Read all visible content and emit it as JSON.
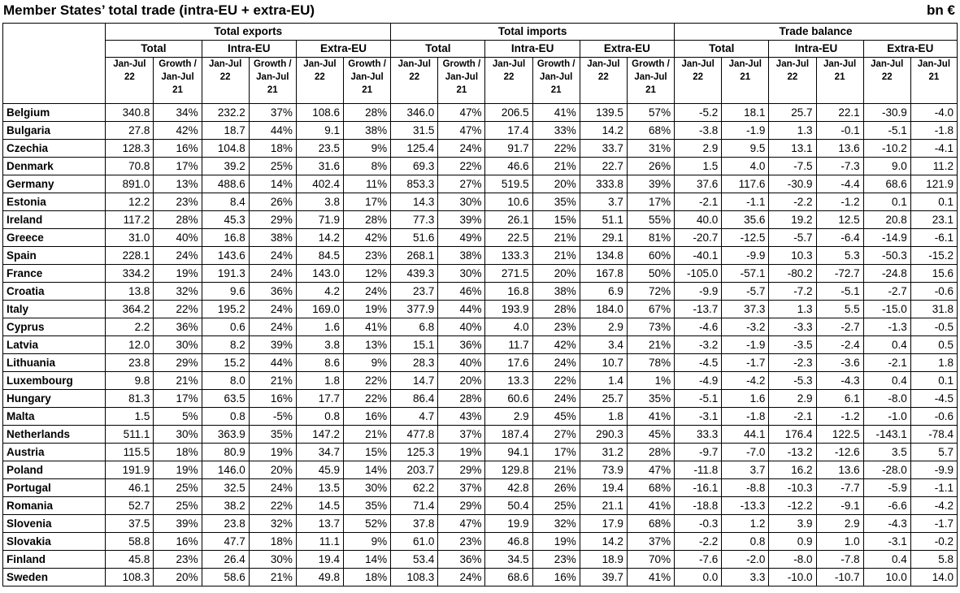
{
  "title": "Member States’ total trade (intra-EU + extra-EU)",
  "unit": "bn €",
  "groups": [
    "Total exports",
    "Total imports",
    "Trade balance"
  ],
  "subgroups": [
    "Total",
    "Intra-EU",
    "Extra-EU",
    "Total",
    "Intra-EU",
    "Extra-EU",
    "Total",
    "Intra-EU",
    "Extra-EU"
  ],
  "cols": [
    "Jan-Jul 22",
    "Growth / Jan-Jul 21",
    "Jan-Jul 22",
    "Growth / Jan-Jul 21",
    "Jan-Jul 22",
    "Growth / Jan-Jul 21",
    "Jan-Jul 22",
    "Growth / Jan-Jul 21",
    "Jan-Jul 22",
    "Growth / Jan-Jul 21",
    "Jan-Jul 22",
    "Growth / Jan-Jul 21",
    "Jan-Jul 22",
    "Jan-Jul 21",
    "Jan-Jul 22",
    "Jan-Jul 21",
    "Jan-Jul 22",
    "Jan-Jul 21"
  ],
  "rows": [
    [
      "Belgium",
      "340.8",
      "34%",
      "232.2",
      "37%",
      "108.6",
      "28%",
      "346.0",
      "47%",
      "206.5",
      "41%",
      "139.5",
      "57%",
      "-5.2",
      "18.1",
      "25.7",
      "22.1",
      "-30.9",
      "-4.0"
    ],
    [
      "Bulgaria",
      "27.8",
      "42%",
      "18.7",
      "44%",
      "9.1",
      "38%",
      "31.5",
      "47%",
      "17.4",
      "33%",
      "14.2",
      "68%",
      "-3.8",
      "-1.9",
      "1.3",
      "-0.1",
      "-5.1",
      "-1.8"
    ],
    [
      "Czechia",
      "128.3",
      "16%",
      "104.8",
      "18%",
      "23.5",
      "9%",
      "125.4",
      "24%",
      "91.7",
      "22%",
      "33.7",
      "31%",
      "2.9",
      "9.5",
      "13.1",
      "13.6",
      "-10.2",
      "-4.1"
    ],
    [
      "Denmark",
      "70.8",
      "17%",
      "39.2",
      "25%",
      "31.6",
      "8%",
      "69.3",
      "22%",
      "46.6",
      "21%",
      "22.7",
      "26%",
      "1.5",
      "4.0",
      "-7.5",
      "-7.3",
      "9.0",
      "11.2"
    ],
    [
      "Germany",
      "891.0",
      "13%",
      "488.6",
      "14%",
      "402.4",
      "11%",
      "853.3",
      "27%",
      "519.5",
      "20%",
      "333.8",
      "39%",
      "37.6",
      "117.6",
      "-30.9",
      "-4.4",
      "68.6",
      "121.9"
    ],
    [
      "Estonia",
      "12.2",
      "23%",
      "8.4",
      "26%",
      "3.8",
      "17%",
      "14.3",
      "30%",
      "10.6",
      "35%",
      "3.7",
      "17%",
      "-2.1",
      "-1.1",
      "-2.2",
      "-1.2",
      "0.1",
      "0.1"
    ],
    [
      "Ireland",
      "117.2",
      "28%",
      "45.3",
      "29%",
      "71.9",
      "28%",
      "77.3",
      "39%",
      "26.1",
      "15%",
      "51.1",
      "55%",
      "40.0",
      "35.6",
      "19.2",
      "12.5",
      "20.8",
      "23.1"
    ],
    [
      "Greece",
      "31.0",
      "40%",
      "16.8",
      "38%",
      "14.2",
      "42%",
      "51.6",
      "49%",
      "22.5",
      "21%",
      "29.1",
      "81%",
      "-20.7",
      "-12.5",
      "-5.7",
      "-6.4",
      "-14.9",
      "-6.1"
    ],
    [
      "Spain",
      "228.1",
      "24%",
      "143.6",
      "24%",
      "84.5",
      "23%",
      "268.1",
      "38%",
      "133.3",
      "21%",
      "134.8",
      "60%",
      "-40.1",
      "-9.9",
      "10.3",
      "5.3",
      "-50.3",
      "-15.2"
    ],
    [
      "France",
      "334.2",
      "19%",
      "191.3",
      "24%",
      "143.0",
      "12%",
      "439.3",
      "30%",
      "271.5",
      "20%",
      "167.8",
      "50%",
      "-105.0",
      "-57.1",
      "-80.2",
      "-72.7",
      "-24.8",
      "15.6"
    ],
    [
      "Croatia",
      "13.8",
      "32%",
      "9.6",
      "36%",
      "4.2",
      "24%",
      "23.7",
      "46%",
      "16.8",
      "38%",
      "6.9",
      "72%",
      "-9.9",
      "-5.7",
      "-7.2",
      "-5.1",
      "-2.7",
      "-0.6"
    ],
    [
      "Italy",
      "364.2",
      "22%",
      "195.2",
      "24%",
      "169.0",
      "19%",
      "377.9",
      "44%",
      "193.9",
      "28%",
      "184.0",
      "67%",
      "-13.7",
      "37.3",
      "1.3",
      "5.5",
      "-15.0",
      "31.8"
    ],
    [
      "Cyprus",
      "2.2",
      "36%",
      "0.6",
      "24%",
      "1.6",
      "41%",
      "6.8",
      "40%",
      "4.0",
      "23%",
      "2.9",
      "73%",
      "-4.6",
      "-3.2",
      "-3.3",
      "-2.7",
      "-1.3",
      "-0.5"
    ],
    [
      "Latvia",
      "12.0",
      "30%",
      "8.2",
      "39%",
      "3.8",
      "13%",
      "15.1",
      "36%",
      "11.7",
      "42%",
      "3.4",
      "21%",
      "-3.2",
      "-1.9",
      "-3.5",
      "-2.4",
      "0.4",
      "0.5"
    ],
    [
      "Lithuania",
      "23.8",
      "29%",
      "15.2",
      "44%",
      "8.6",
      "9%",
      "28.3",
      "40%",
      "17.6",
      "24%",
      "10.7",
      "78%",
      "-4.5",
      "-1.7",
      "-2.3",
      "-3.6",
      "-2.1",
      "1.8"
    ],
    [
      "Luxembourg",
      "9.8",
      "21%",
      "8.0",
      "21%",
      "1.8",
      "22%",
      "14.7",
      "20%",
      "13.3",
      "22%",
      "1.4",
      "1%",
      "-4.9",
      "-4.2",
      "-5.3",
      "-4.3",
      "0.4",
      "0.1"
    ],
    [
      "Hungary",
      "81.3",
      "17%",
      "63.5",
      "16%",
      "17.7",
      "22%",
      "86.4",
      "28%",
      "60.6",
      "24%",
      "25.7",
      "35%",
      "-5.1",
      "1.6",
      "2.9",
      "6.1",
      "-8.0",
      "-4.5"
    ],
    [
      "Malta",
      "1.5",
      "5%",
      "0.8",
      "-5%",
      "0.8",
      "16%",
      "4.7",
      "43%",
      "2.9",
      "45%",
      "1.8",
      "41%",
      "-3.1",
      "-1.8",
      "-2.1",
      "-1.2",
      "-1.0",
      "-0.6"
    ],
    [
      "Netherlands",
      "511.1",
      "30%",
      "363.9",
      "35%",
      "147.2",
      "21%",
      "477.8",
      "37%",
      "187.4",
      "27%",
      "290.3",
      "45%",
      "33.3",
      "44.1",
      "176.4",
      "122.5",
      "-143.1",
      "-78.4"
    ],
    [
      "Austria",
      "115.5",
      "18%",
      "80.9",
      "19%",
      "34.7",
      "15%",
      "125.3",
      "19%",
      "94.1",
      "17%",
      "31.2",
      "28%",
      "-9.7",
      "-7.0",
      "-13.2",
      "-12.6",
      "3.5",
      "5.7"
    ],
    [
      "Poland",
      "191.9",
      "19%",
      "146.0",
      "20%",
      "45.9",
      "14%",
      "203.7",
      "29%",
      "129.8",
      "21%",
      "73.9",
      "47%",
      "-11.8",
      "3.7",
      "16.2",
      "13.6",
      "-28.0",
      "-9.9"
    ],
    [
      "Portugal",
      "46.1",
      "25%",
      "32.5",
      "24%",
      "13.5",
      "30%",
      "62.2",
      "37%",
      "42.8",
      "26%",
      "19.4",
      "68%",
      "-16.1",
      "-8.8",
      "-10.3",
      "-7.7",
      "-5.9",
      "-1.1"
    ],
    [
      "Romania",
      "52.7",
      "25%",
      "38.2",
      "22%",
      "14.5",
      "35%",
      "71.4",
      "29%",
      "50.4",
      "25%",
      "21.1",
      "41%",
      "-18.8",
      "-13.3",
      "-12.2",
      "-9.1",
      "-6.6",
      "-4.2"
    ],
    [
      "Slovenia",
      "37.5",
      "39%",
      "23.8",
      "32%",
      "13.7",
      "52%",
      "37.8",
      "47%",
      "19.9",
      "32%",
      "17.9",
      "68%",
      "-0.3",
      "1.2",
      "3.9",
      "2.9",
      "-4.3",
      "-1.7"
    ],
    [
      "Slovakia",
      "58.8",
      "16%",
      "47.7",
      "18%",
      "11.1",
      "9%",
      "61.0",
      "23%",
      "46.8",
      "19%",
      "14.2",
      "37%",
      "-2.2",
      "0.8",
      "0.9",
      "1.0",
      "-3.1",
      "-0.2"
    ],
    [
      "Finland",
      "45.8",
      "23%",
      "26.4",
      "30%",
      "19.4",
      "14%",
      "53.4",
      "36%",
      "34.5",
      "23%",
      "18.9",
      "70%",
      "-7.6",
      "-2.0",
      "-8.0",
      "-7.8",
      "0.4",
      "5.8"
    ],
    [
      "Sweden",
      "108.3",
      "20%",
      "58.6",
      "21%",
      "49.8",
      "18%",
      "108.3",
      "24%",
      "68.6",
      "16%",
      "39.7",
      "41%",
      "0.0",
      "3.3",
      "-10.0",
      "-10.7",
      "10.0",
      "14.0"
    ]
  ]
}
